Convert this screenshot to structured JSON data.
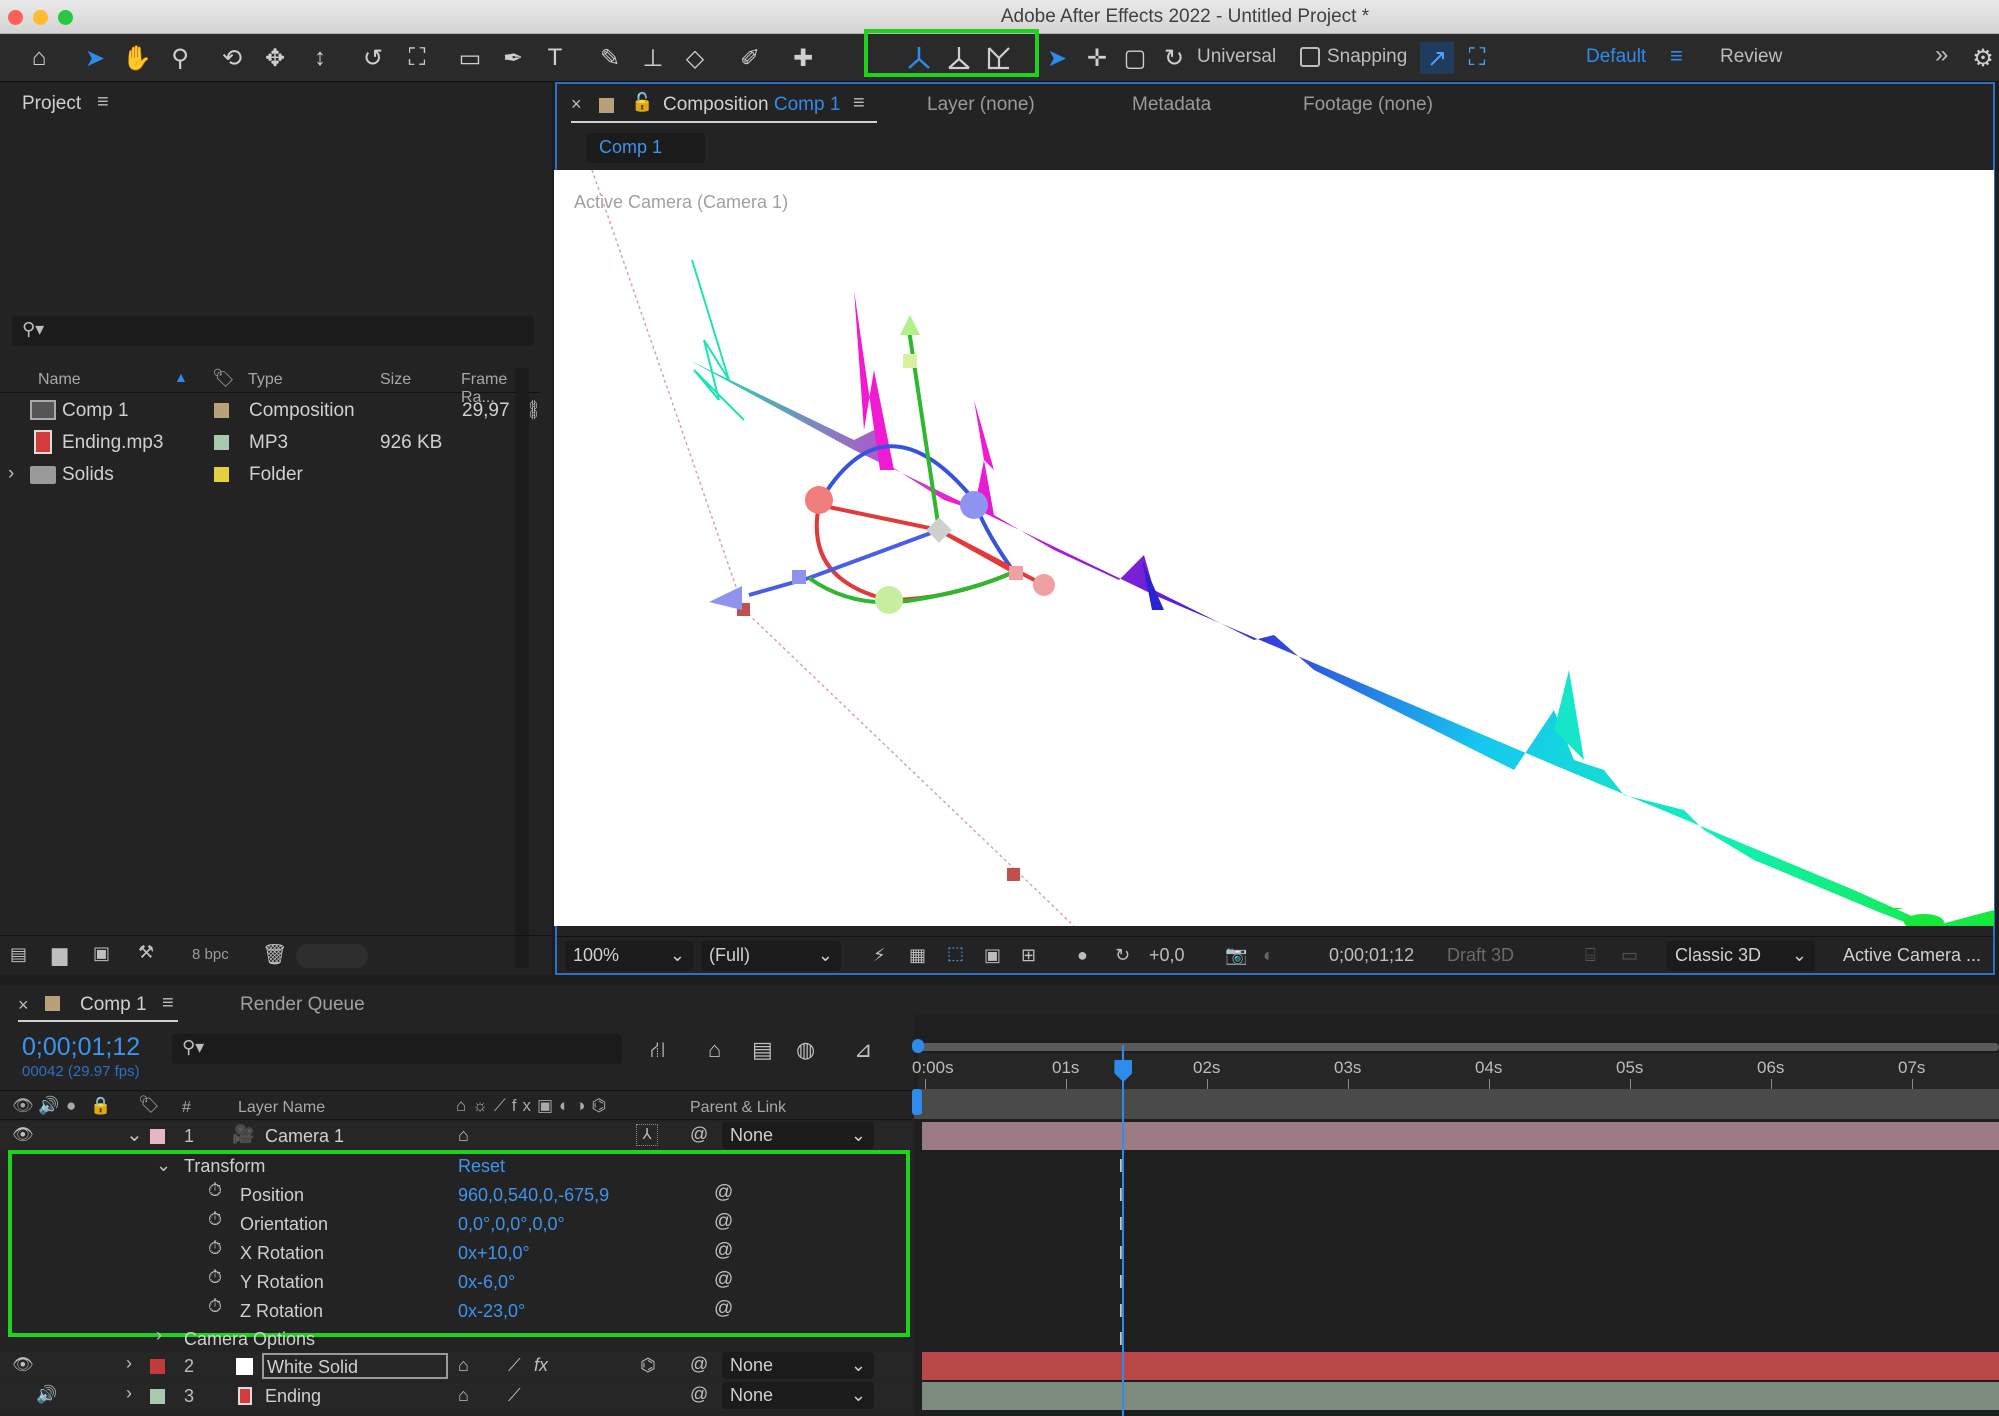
{
  "window": {
    "title": "Adobe After Effects 2022 - Untitled Project *"
  },
  "toolbar": {
    "tools": [
      "home-icon",
      "selection-icon",
      "hand-icon",
      "zoom-icon",
      "orbit-icon",
      "pan-icon",
      "dolly-icon",
      "rotate-icon",
      "anchor-icon",
      "rectangle-icon",
      "pen-icon",
      "type-icon",
      "brush-icon",
      "clone-stamp-icon",
      "eraser-icon",
      "roto-brush-icon",
      "puppet-icon"
    ],
    "axis_modes": [
      "local-axis-icon",
      "world-axis-icon",
      "view-axis-icon"
    ],
    "universal_label": "Universal",
    "snapping_label": "Snapping",
    "workspace_default": "Default",
    "workspace_review": "Review",
    "more_glyph": "»"
  },
  "project": {
    "title": "Project",
    "search_placeholder": "",
    "columns": {
      "name": "Name",
      "type": "Type",
      "size": "Size",
      "frame_rate": "Frame Ra..."
    },
    "items": [
      {
        "name": "Comp 1",
        "label_color": "#b8a07a",
        "type": "Composition",
        "size": "",
        "frame_rate": "29,97"
      },
      {
        "name": "Ending.mp3",
        "label_color": "#a9c9ae",
        "type": "MP3",
        "size": "926 KB",
        "frame_rate": ""
      },
      {
        "name": "Solids",
        "label_color": "#e3cf40",
        "type": "Folder",
        "size": "",
        "frame_rate": ""
      }
    ],
    "bpc": "8 bpc"
  },
  "viewer": {
    "tabs": {
      "composition_prefix": "Composition",
      "composition_name": "Comp 1",
      "layer": "Layer (none)",
      "metadata": "Metadata",
      "footage": "Footage (none)"
    },
    "subtab": "Comp 1",
    "camera_label": "Active Camera (Camera 1)",
    "zoom": "100%",
    "resolution": "(Full)",
    "exposure": "+0,0",
    "timecode": "0;00;01;12",
    "draft3d": "Draft 3D",
    "renderer": "Classic 3D",
    "view": "Active Camera ..."
  },
  "timeline": {
    "tab_comp": "Comp 1",
    "tab_render": "Render Queue",
    "timecode": "0;00;01;12",
    "frame_info": "00042 (29.97 fps)",
    "col_num": "#",
    "col_layer_name": "Layer Name",
    "col_parent": "Parent & Link",
    "ruler": [
      "0:00s",
      "01s",
      "02s",
      "03s",
      "04s",
      "05s",
      "06s",
      "07s"
    ],
    "current_time_seconds": 1.4,
    "layers": [
      {
        "num": "1",
        "name": "Camera 1",
        "label_color": "#e8b6c2",
        "parent": "None",
        "bar_color": "#9a7a84"
      },
      {
        "num": "2",
        "name": "White Solid",
        "label_color": "#c23a3a",
        "parent": "None",
        "bar_color": "#b84848"
      },
      {
        "num": "3",
        "name": "Ending",
        "label_color": "#a9c9ae",
        "parent": "None",
        "bar_color": "#7d8a7e"
      }
    ],
    "transform": {
      "label": "Transform",
      "reset": "Reset",
      "props": [
        {
          "name": "Position",
          "value": "960,0,540,0,-675,9"
        },
        {
          "name": "Orientation",
          "value": "0,0°,0,0°,0,0°"
        },
        {
          "name": "X Rotation",
          "value": "0x+10,0°"
        },
        {
          "name": "Y Rotation",
          "value": "0x-6,0°"
        },
        {
          "name": "Z Rotation",
          "value": "0x-23,0°"
        }
      ],
      "camera_options": "Camera Options"
    }
  },
  "colors": {
    "accent": "#2d8ceb",
    "highlight": "#1ed21e"
  }
}
